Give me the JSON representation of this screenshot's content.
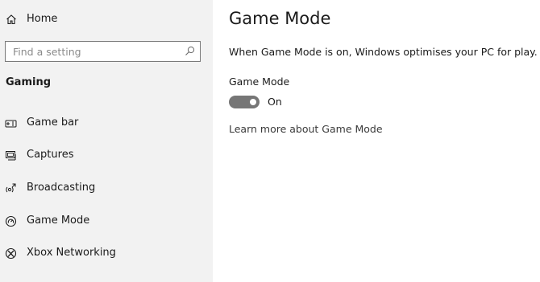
{
  "sidebar": {
    "home_label": "Home",
    "search_placeholder": "Find a setting",
    "section_title": "Gaming",
    "items": [
      {
        "label": "Game bar",
        "icon": "game-bar-icon"
      },
      {
        "label": "Captures",
        "icon": "captures-icon"
      },
      {
        "label": "Broadcasting",
        "icon": "broadcasting-icon"
      },
      {
        "label": "Game Mode",
        "icon": "game-mode-icon"
      },
      {
        "label": "Xbox Networking",
        "icon": "xbox-icon"
      }
    ]
  },
  "main": {
    "title": "Game Mode",
    "description": "When Game Mode is on, Windows optimises your PC for play.",
    "setting_label": "Game Mode",
    "toggle_state": "On",
    "learn_more": "Learn more about Game Mode"
  }
}
